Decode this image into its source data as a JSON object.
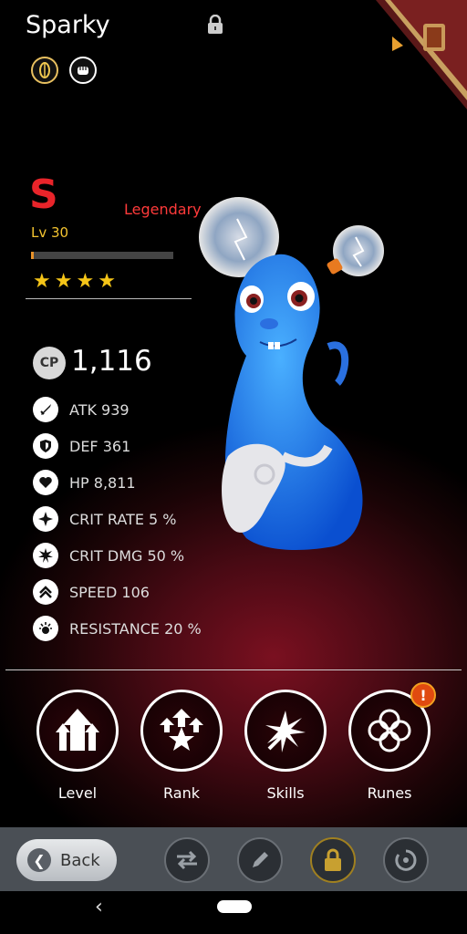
{
  "header": {
    "name": "Sparky"
  },
  "grade": "S",
  "rarity": "Legendary",
  "level_label": "Lv 30",
  "xp_progress": 0.02,
  "stars": 4,
  "cp": {
    "badge": "CP",
    "value": "1,116"
  },
  "stats": [
    {
      "icon": "sword-icon",
      "label": "ATK 939"
    },
    {
      "icon": "shield-icon",
      "label": "DEF 361"
    },
    {
      "icon": "heart-icon",
      "label": "HP 8,811"
    },
    {
      "icon": "crit-rate-icon",
      "label": "CRIT RATE 5 %"
    },
    {
      "icon": "crit-dmg-icon",
      "label": "CRIT DMG 50 %"
    },
    {
      "icon": "speed-icon",
      "label": "SPEED 106"
    },
    {
      "icon": "resistance-icon",
      "label": "RESISTANCE 20 %"
    }
  ],
  "actions": [
    {
      "label": "Level",
      "icon": "level-up-arrows-icon"
    },
    {
      "label": "Rank",
      "icon": "rank-star-icon"
    },
    {
      "label": "Skills",
      "icon": "skills-burst-icon"
    },
    {
      "label": "Runes",
      "icon": "runes-knot-icon"
    }
  ],
  "runes_alert": "!",
  "toolbar": {
    "back_label": "Back"
  },
  "colors": {
    "grade": "#e8242a",
    "rarity": "#ff3a3a",
    "level": "#f4c430",
    "stars": "#f5c518",
    "accent_bg": "#7a1020"
  }
}
